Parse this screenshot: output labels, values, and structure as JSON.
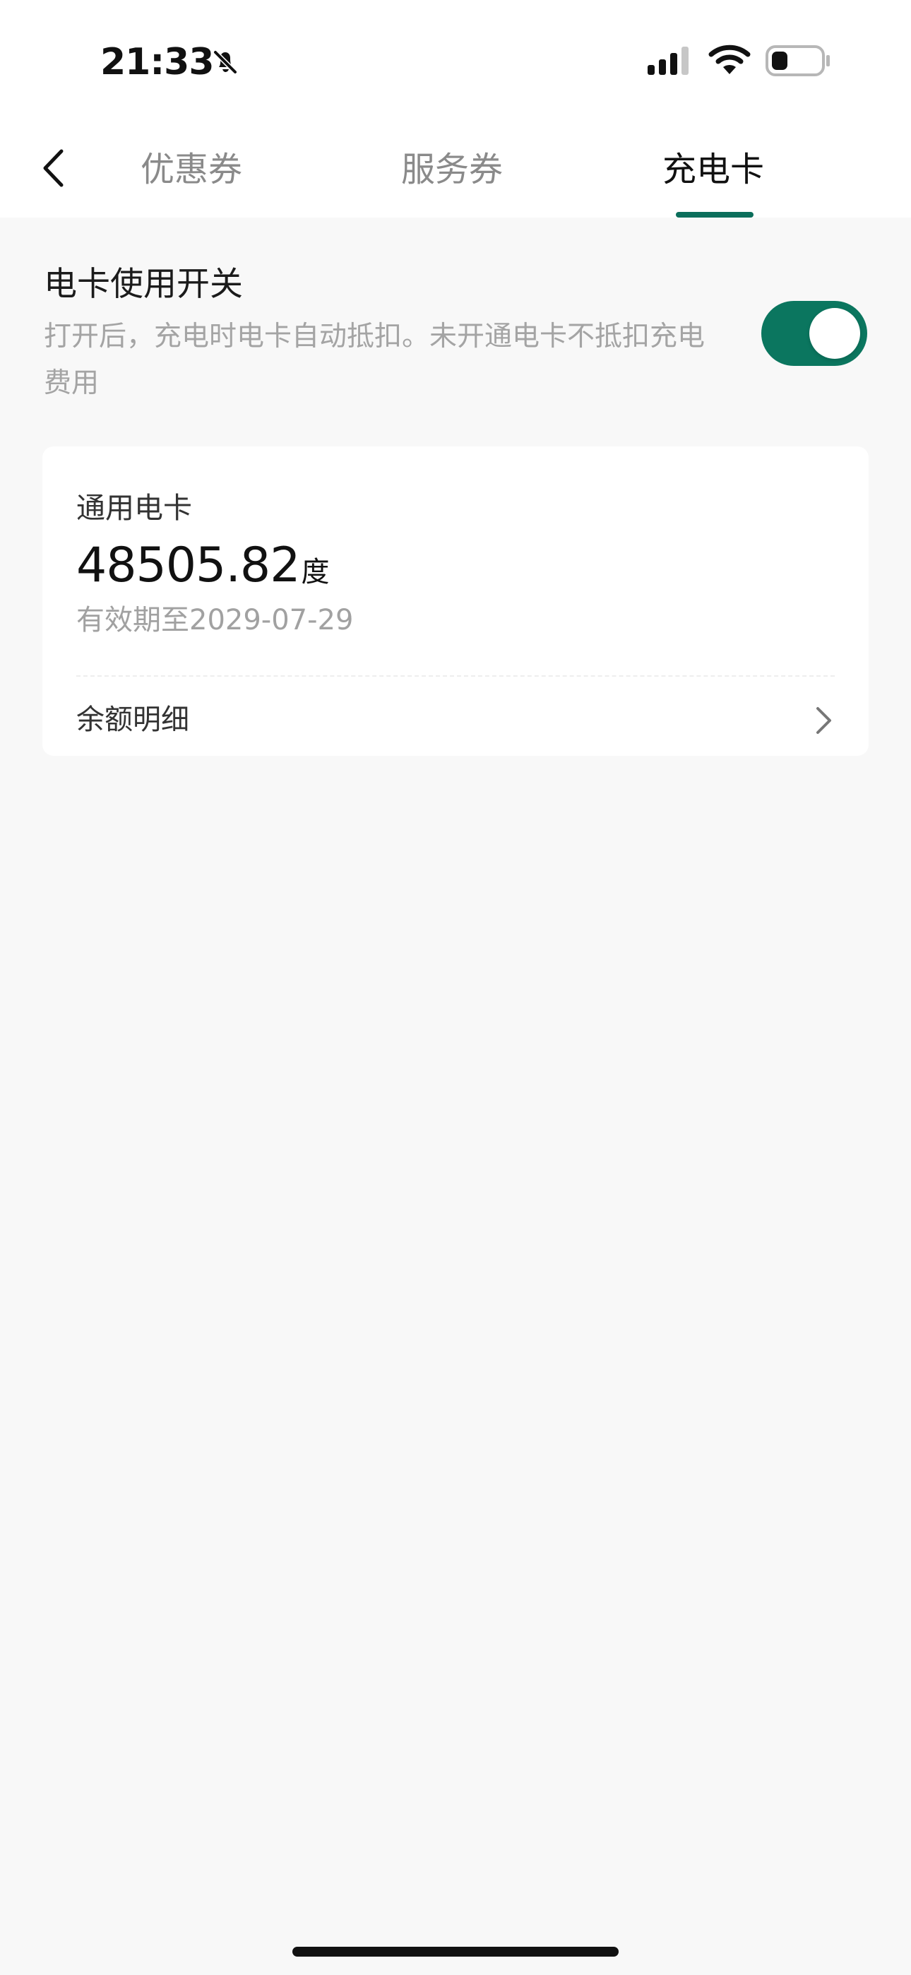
{
  "status_bar": {
    "time": "21:33",
    "icons": {
      "notification": "bell-off-icon",
      "signal": "signal-icon",
      "wifi": "wifi-icon",
      "battery": "battery-icon"
    }
  },
  "navigation": {
    "back_icon": "chevron-left-icon",
    "tabs": [
      {
        "label": "优惠券",
        "selected": false
      },
      {
        "label": "服务券",
        "selected": false
      },
      {
        "label": "充电卡",
        "selected": true
      }
    ],
    "active_color": "#0b6e5b"
  },
  "card_switch": {
    "title": "电卡使用开关",
    "description": "打开后，充电时电卡自动抵扣。未开通电卡不抵扣充电费用",
    "enabled": true,
    "toggle_color": "#0b765f"
  },
  "charge_card": {
    "title": "通用电卡",
    "balance": "48505.82",
    "unit": "度",
    "expiry": "有效期至2029-07-29",
    "detail_label": "余额明细",
    "detail_icon": "chevron-right-icon"
  }
}
